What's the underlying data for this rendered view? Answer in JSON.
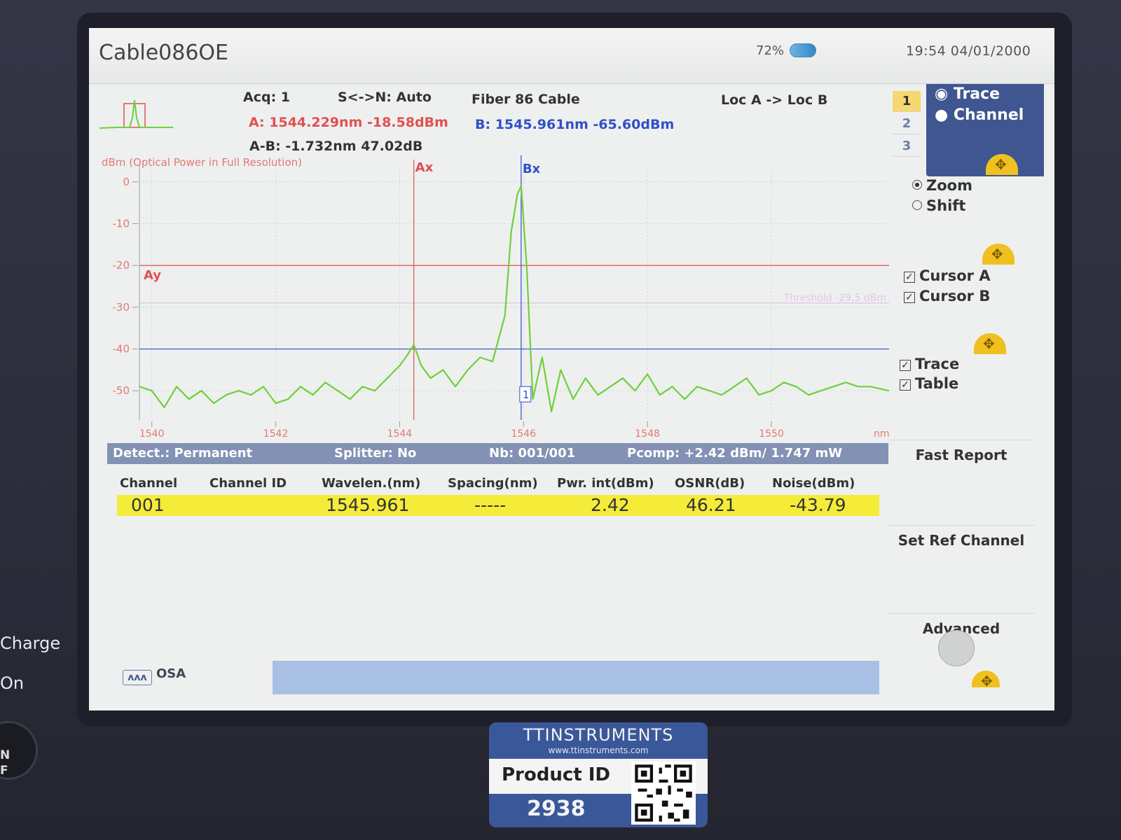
{
  "title_bar": {
    "file_name": "Cable086OE",
    "battery_pct": "72%",
    "clock": "19:54  04/01/2000"
  },
  "info": {
    "acq": "Acq: 1",
    "sn": "S<->N: Auto",
    "fiber": "Fiber  86  Cable",
    "loc": "Loc A -> Loc B",
    "cursor_a": "A: 1544.229nm -18.58dBm",
    "cursor_b": "B: 1545.961nm -65.60dBm",
    "a_minus_b": "A-B: -1.732nm  47.02dB"
  },
  "pages": [
    "1",
    "2",
    "3"
  ],
  "right_panel": {
    "mode_trace": "Trace",
    "mode_channel": "Channel",
    "zoom": "Zoom",
    "shift": "Shift",
    "cursor_a": "Cursor A",
    "cursor_b": "Cursor B",
    "trace": "Trace",
    "table": "Table",
    "fast_report": "Fast Report",
    "set_ref_channel": "Set Ref Channel",
    "advanced": "Advanced"
  },
  "colors": {
    "trace": "#6ed03c",
    "cursor_a": "#e05050",
    "cursor_b": "#3050c8",
    "highlight_row": "#f4ec38",
    "panel_blue": "#3f5691"
  },
  "chart_data": {
    "type": "line",
    "ylabel": "dBm  (Optical Power in Full Resolution)",
    "xlabel": "nm",
    "xlim": [
      1539.8,
      1551.9
    ],
    "ylim": [
      -57,
      4
    ],
    "x_ticks": [
      1540,
      1542,
      1544,
      1546,
      1548,
      1550
    ],
    "y_ticks": [
      0,
      -10,
      -20,
      -30,
      -40,
      -50
    ],
    "markers": {
      "ax": "Ax",
      "bx": "Bx",
      "ay": "Ay",
      "channel_tag": "1"
    },
    "cursor_a_x": 1544.229,
    "cursor_b_x": 1545.961,
    "cursor_a_y": -20,
    "cursor_b_y": -40,
    "threshold_y": -29,
    "threshold_label": "Threshold -29.5 dBm",
    "series": [
      {
        "x": [
          1539.8,
          1540.0,
          1540.2,
          1540.4,
          1540.6,
          1540.8,
          1541.0,
          1541.2,
          1541.4,
          1541.6,
          1541.8,
          1542.0,
          1542.2,
          1542.4,
          1542.6,
          1542.8,
          1543.0,
          1543.2,
          1543.4,
          1543.6,
          1543.8,
          1544.0,
          1544.1,
          1544.229,
          1544.35,
          1544.5,
          1544.7,
          1544.9,
          1545.1,
          1545.3,
          1545.5,
          1545.7,
          1545.8,
          1545.9,
          1545.961,
          1546.05,
          1546.15,
          1546.3,
          1546.45,
          1546.6,
          1546.8,
          1547.0,
          1547.2,
          1547.4,
          1547.6,
          1547.8,
          1548.0,
          1548.2,
          1548.4,
          1548.6,
          1548.8,
          1549.0,
          1549.2,
          1549.4,
          1549.6,
          1549.8,
          1550.0,
          1550.2,
          1550.4,
          1550.6,
          1550.8,
          1551.0,
          1551.2,
          1551.4,
          1551.6,
          1551.9
        ],
        "y": [
          -49,
          -50,
          -54,
          -49,
          -52,
          -50,
          -53,
          -51,
          -50,
          -51,
          -49,
          -53,
          -52,
          -49,
          -51,
          -48,
          -50,
          -52,
          -49,
          -50,
          -47,
          -44,
          -42,
          -39,
          -44,
          -47,
          -45,
          -49,
          -45,
          -42,
          -43,
          -32,
          -12,
          -3,
          -1,
          -20,
          -52,
          -42,
          -55,
          -45,
          -52,
          -47,
          -51,
          -49,
          -47,
          -50,
          -46,
          -51,
          -49,
          -52,
          -49,
          -50,
          -51,
          -49,
          -47,
          -51,
          -50,
          -48,
          -49,
          -51,
          -50,
          -49,
          -48,
          -49,
          -49,
          -50
        ]
      }
    ]
  },
  "detect_bar": {
    "detect": "Detect.: Permanent",
    "splitter": "Splitter: No",
    "nb": "Nb: 001/001",
    "pcomp": "Pcomp:  +2.42 dBm/ 1.747 mW"
  },
  "table": {
    "headers": [
      "Channel",
      "Channel ID",
      "Wavelen.(nm)",
      "Spacing(nm)",
      "Pwr. int(dBm)",
      "OSNR(dB)",
      "Noise(dBm)"
    ],
    "rows": [
      {
        "channel": "001",
        "channel_id": "",
        "wavelength": "1545.961",
        "spacing": "-----",
        "pwr_int": "2.42",
        "osnr": "46.21",
        "noise": "-43.79"
      }
    ]
  },
  "bottom": {
    "osa_tab": "OSA"
  },
  "bezel": {
    "charge": "Charge",
    "on": "On",
    "power": "N\nF"
  },
  "sticker": {
    "brand": "TTINSTRUMENTS",
    "url": "www.ttinstruments.com",
    "product_label": "Product ID",
    "product_id": "2938"
  }
}
